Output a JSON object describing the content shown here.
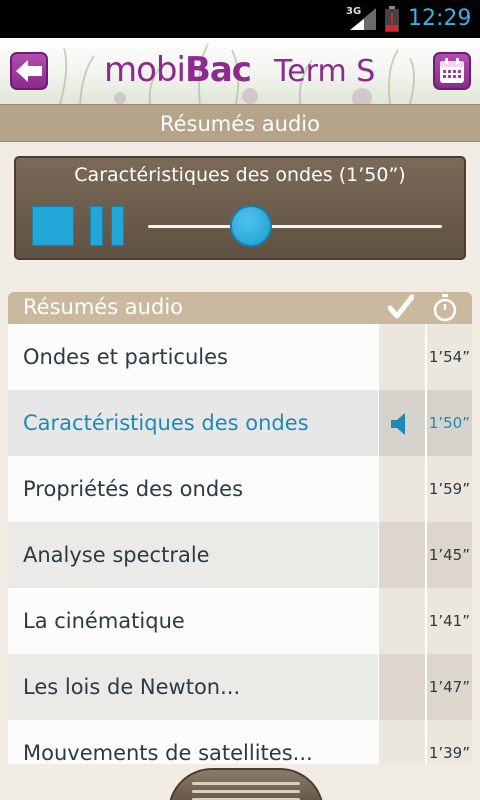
{
  "status_bar": {
    "network": "3G",
    "time": "12:29",
    "time_color": "#32b5e5",
    "battery_color": "#d32b2b"
  },
  "header": {
    "logo_part1": "mobi",
    "logo_part2": "Bac",
    "level": "Term S",
    "back_icon": "back-arrow-icon",
    "calendar_icon": "calendar-icon",
    "brand_color": "#8d2a8f"
  },
  "section_title": "Résumés audio",
  "player": {
    "title": "Caractéristiques des ondes  (1’50”)",
    "progress": 0.35,
    "accent_color": "#22a7d8"
  },
  "list": {
    "header_label": "Résumés audio",
    "check_icon": "checkmark-icon",
    "timer_icon": "stopwatch-icon",
    "items": [
      {
        "title": "Ondes et particules",
        "duration": "1’54”",
        "playing": false
      },
      {
        "title": "Caractéristiques des ondes",
        "duration": "1’50”",
        "playing": true
      },
      {
        "title": "Propriétés des ondes",
        "duration": "1’59”",
        "playing": false
      },
      {
        "title": "Analyse spectrale",
        "duration": "1’45”",
        "playing": false
      },
      {
        "title": "La cinématique",
        "duration": "1’41”",
        "playing": false
      },
      {
        "title": "Les lois de Newton...",
        "duration": "1’47”",
        "playing": false
      },
      {
        "title": "Mouvements de satellites...",
        "duration": "1’39”",
        "playing": false
      }
    ]
  }
}
